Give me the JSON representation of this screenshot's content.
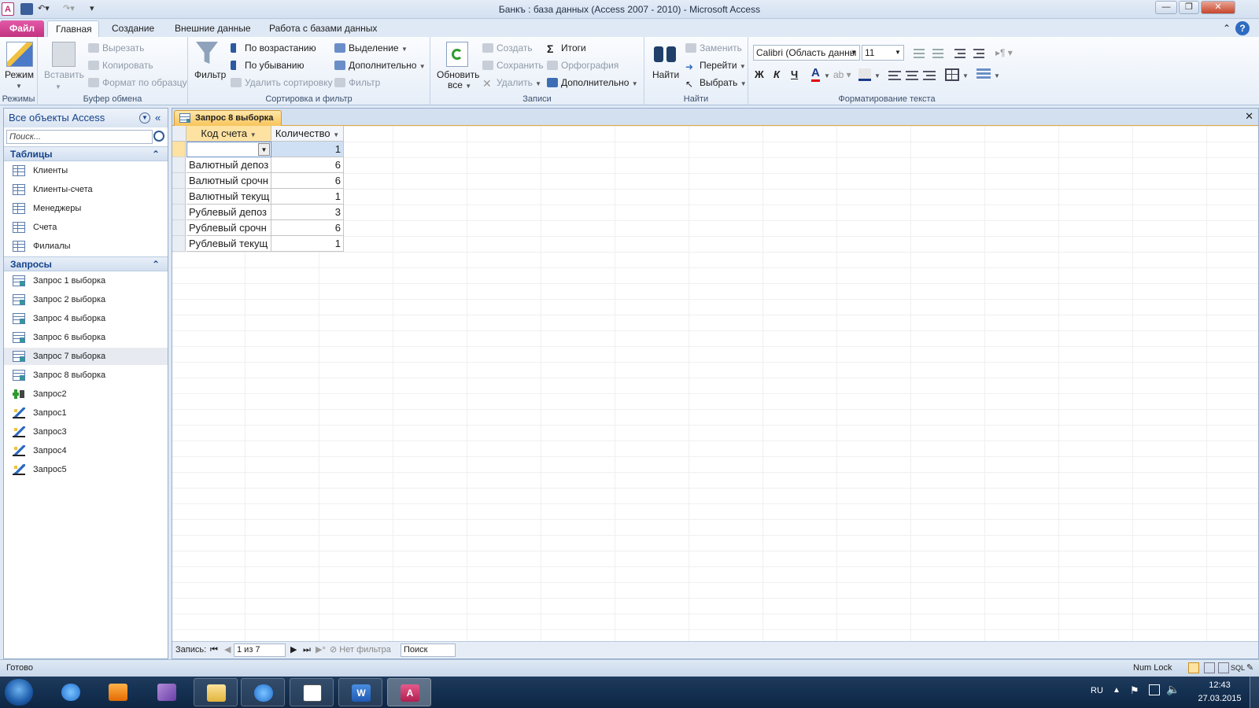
{
  "window": {
    "title": "Банкъ : база данных (Access 2007 - 2010)  -  Microsoft Access",
    "app_icon": "A",
    "buttons": {
      "minimize": "—",
      "restore": "❐",
      "close": "✕"
    }
  },
  "tabs": [
    "Файл",
    "Главная",
    "Создание",
    "Внешние данные",
    "Работа с базами данных"
  ],
  "ribbon": {
    "views": {
      "label": "Режим",
      "group": "Режимы"
    },
    "clipboard": {
      "paste": "Вставить",
      "cut": "Вырезать",
      "copy": "Копировать",
      "format_painter": "Формат по образцу",
      "group": "Буфер обмена"
    },
    "sort_filter": {
      "filter": "Фильтр",
      "ascending": "По возрастанию",
      "descending": "По убыванию",
      "remove_sort": "Удалить сортировку",
      "selection": "Выделение",
      "advanced": "Дополнительно",
      "toggle_filter": "Фильтр",
      "group": "Сортировка и фильтр"
    },
    "records": {
      "refresh": "Обновить",
      "refresh2": "все",
      "new": "Создать",
      "save": "Сохранить",
      "delete": "Удалить",
      "totals": "Итоги",
      "spelling": "Орфография",
      "more": "Дополнительно",
      "group": "Записи"
    },
    "find": {
      "find": "Найти",
      "replace": "Заменить",
      "goto": "Перейти",
      "select": "Выбрать",
      "group": "Найти"
    },
    "text_format": {
      "font": "Calibri (Область данны",
      "size": "11",
      "bold": "Ж",
      "italic": "К",
      "underline": "Ч",
      "group": "Форматирование текста"
    }
  },
  "nav": {
    "title": "Все объекты Access",
    "search_placeholder": "Поиск...",
    "tables_header": "Таблицы",
    "tables": [
      "Клиенты",
      "Клиенты-счета",
      "Менеджеры",
      "Счета",
      "Филиалы"
    ],
    "queries_header": "Запросы",
    "queries": [
      "Запрос 1 выборка",
      "Запрос 2 выборка",
      "Запрос 4 выборка",
      "Запрос 6 выборка",
      "Запрос 7 выборка",
      "Запрос 8 выборка",
      "Запрос2",
      "Запрос1",
      "Запрос3",
      "Запрос4",
      "Запрос5"
    ]
  },
  "document": {
    "tab_title": "Запрос 8 выборка",
    "columns": [
      "Код счета",
      "Количество"
    ],
    "rows": [
      [
        "",
        "1"
      ],
      [
        "Валютный депоз",
        "6"
      ],
      [
        "Валютный срочн",
        "6"
      ],
      [
        "Валютный текущ",
        "1"
      ],
      [
        "Рублевый депоз",
        "3"
      ],
      [
        "Рублевый срочн",
        "6"
      ],
      [
        "Рублевый текущ",
        "1"
      ]
    ],
    "record_nav": {
      "label": "Запись:",
      "position": "1 из 7",
      "filter": "Нет фильтра",
      "search": "Поиск"
    }
  },
  "status": {
    "text": "Готово",
    "numlock": "Num Lock"
  },
  "taskbar": {
    "lang": "RU",
    "time": "12:43",
    "date": "27.03.2015"
  },
  "colors": {
    "accent_file": "#c0307e",
    "active_tab": "#f8c45c",
    "header_cell": "#fde2a2"
  }
}
